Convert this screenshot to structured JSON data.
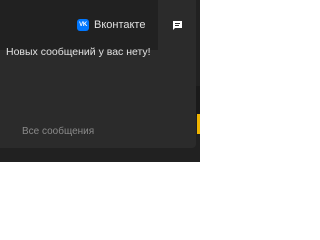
{
  "tabs": {
    "vk": {
      "logo_text": "VK",
      "label": "Вконтакте",
      "icon": "vk-logo-icon",
      "brand_color": "#0077ff"
    },
    "messages": {
      "icon": "message-icon",
      "active": true
    }
  },
  "notifications": {
    "empty_text": "Новых сообщений у вас нету!",
    "all_messages_link": "Все сообщения"
  },
  "colors": {
    "panel_bg": "#212121",
    "content_bg": "#2b2b2b",
    "accent": "#f0b400"
  }
}
